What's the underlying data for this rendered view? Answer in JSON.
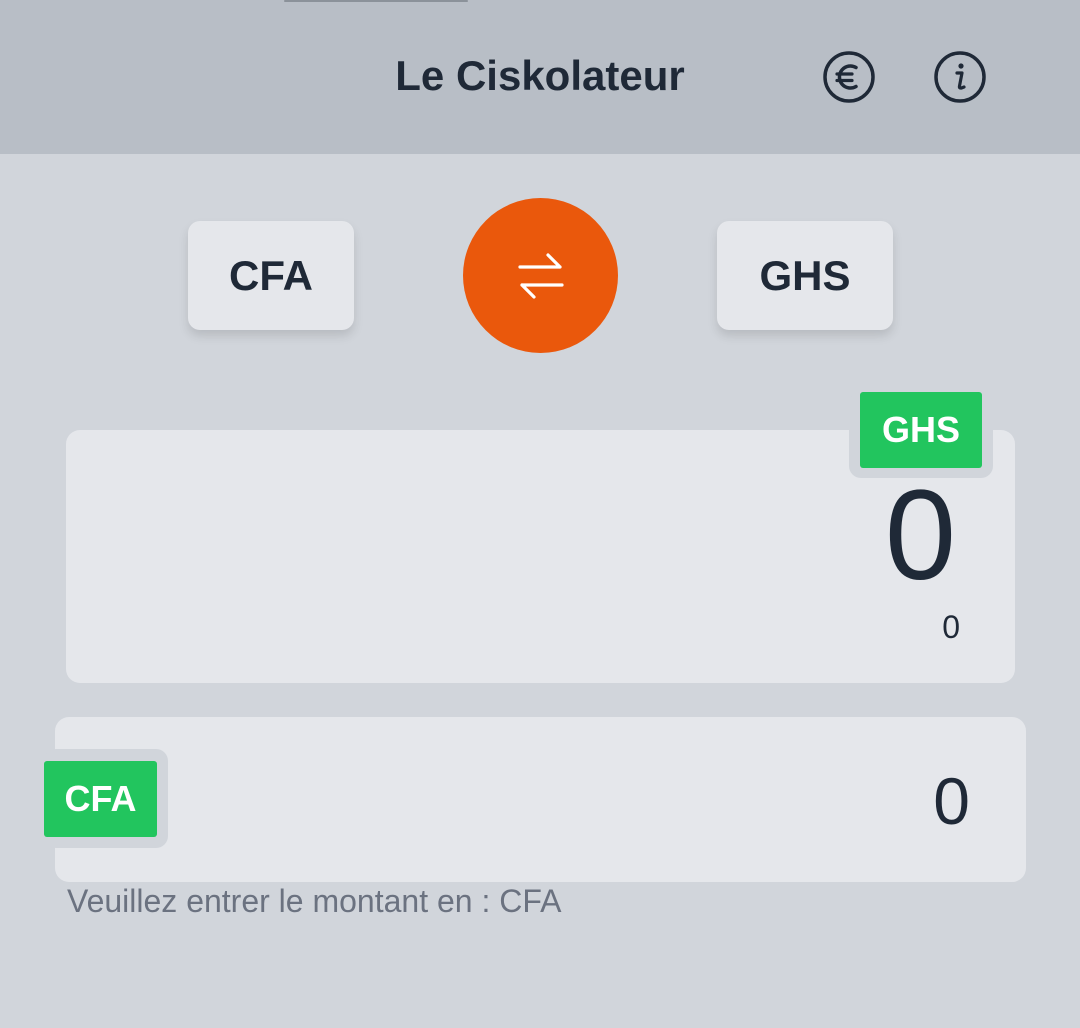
{
  "header": {
    "title": "Le Ciskolateur",
    "euro_icon": "euro-icon",
    "info_icon": "info-icon"
  },
  "selector": {
    "from_currency": "CFA",
    "to_currency": "GHS",
    "swap_icon": "swap-arrows-icon"
  },
  "result": {
    "badge": "GHS",
    "value": "0",
    "secondary_value": "0"
  },
  "input": {
    "badge": "CFA",
    "value": "0",
    "hint": "Veuillez entrer le montant en : CFA"
  },
  "colors": {
    "accent": "#ea580c",
    "badge": "#22c55e",
    "header_bg": "#b8bec6",
    "page_bg": "#d1d5db",
    "card_bg": "#e5e7eb",
    "text": "#1f2937"
  }
}
